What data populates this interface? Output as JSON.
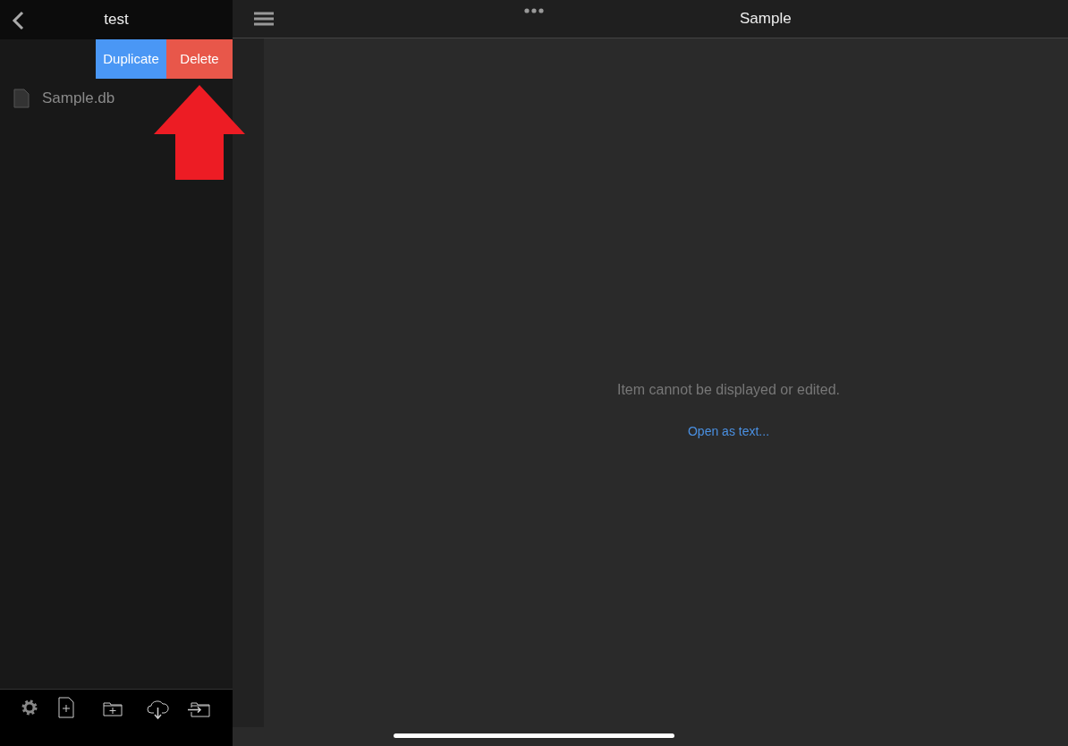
{
  "sidebar": {
    "title": "test",
    "row_actions": [
      {
        "label": "Duplicate",
        "kind": "duplicate"
      },
      {
        "label": "Delete",
        "kind": "delete"
      }
    ],
    "files": [
      {
        "name": "Sample.db"
      }
    ]
  },
  "editor": {
    "title": "Sample",
    "message": "Item cannot be displayed or edited.",
    "link": "Open as text..."
  }
}
